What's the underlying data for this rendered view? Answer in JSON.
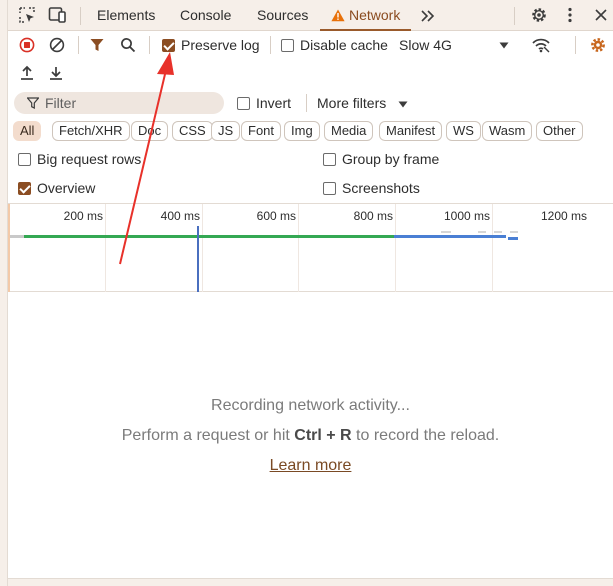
{
  "tabs": [
    {
      "label": "Elements"
    },
    {
      "label": "Console"
    },
    {
      "label": "Sources"
    },
    {
      "label": "Network",
      "active": true
    }
  ],
  "toolbar": {
    "preserve_log_label": "Preserve log",
    "preserve_log_checked": true,
    "disable_cache_label": "Disable cache",
    "disable_cache_checked": false,
    "throttle_value": "Slow 4G"
  },
  "filter": {
    "placeholder": "Filter",
    "invert_label": "Invert",
    "more_filters_label": "More filters"
  },
  "type_filters": [
    "All",
    "Fetch/XHR",
    "Doc",
    "CSS",
    "JS",
    "Font",
    "Img",
    "Media",
    "Manifest",
    "WS",
    "Wasm",
    "Other"
  ],
  "settings": {
    "big_request_rows_label": "Big request rows",
    "group_by_frame_label": "Group by frame",
    "overview_label": "Overview",
    "screenshots_label": "Screenshots",
    "big_request_rows_checked": false,
    "group_by_frame_checked": false,
    "overview_checked": true,
    "screenshots_checked": false
  },
  "timeline": {
    "ticks": [
      "200 ms",
      "400 ms",
      "600 ms",
      "800 ms",
      "1000 ms",
      "1200 ms"
    ]
  },
  "empty_state": {
    "title": "Recording network activity...",
    "sub_before": "Perform a request or hit ",
    "shortcut": "Ctrl + R",
    "sub_after": " to record the reload.",
    "link": "Learn more"
  },
  "colors": {
    "accent": "#8b4d22",
    "record_red": "#d93025",
    "warning_orange": "#e8710a",
    "timeline_green": "#34a853",
    "timeline_blue": "#4a7fd4"
  }
}
